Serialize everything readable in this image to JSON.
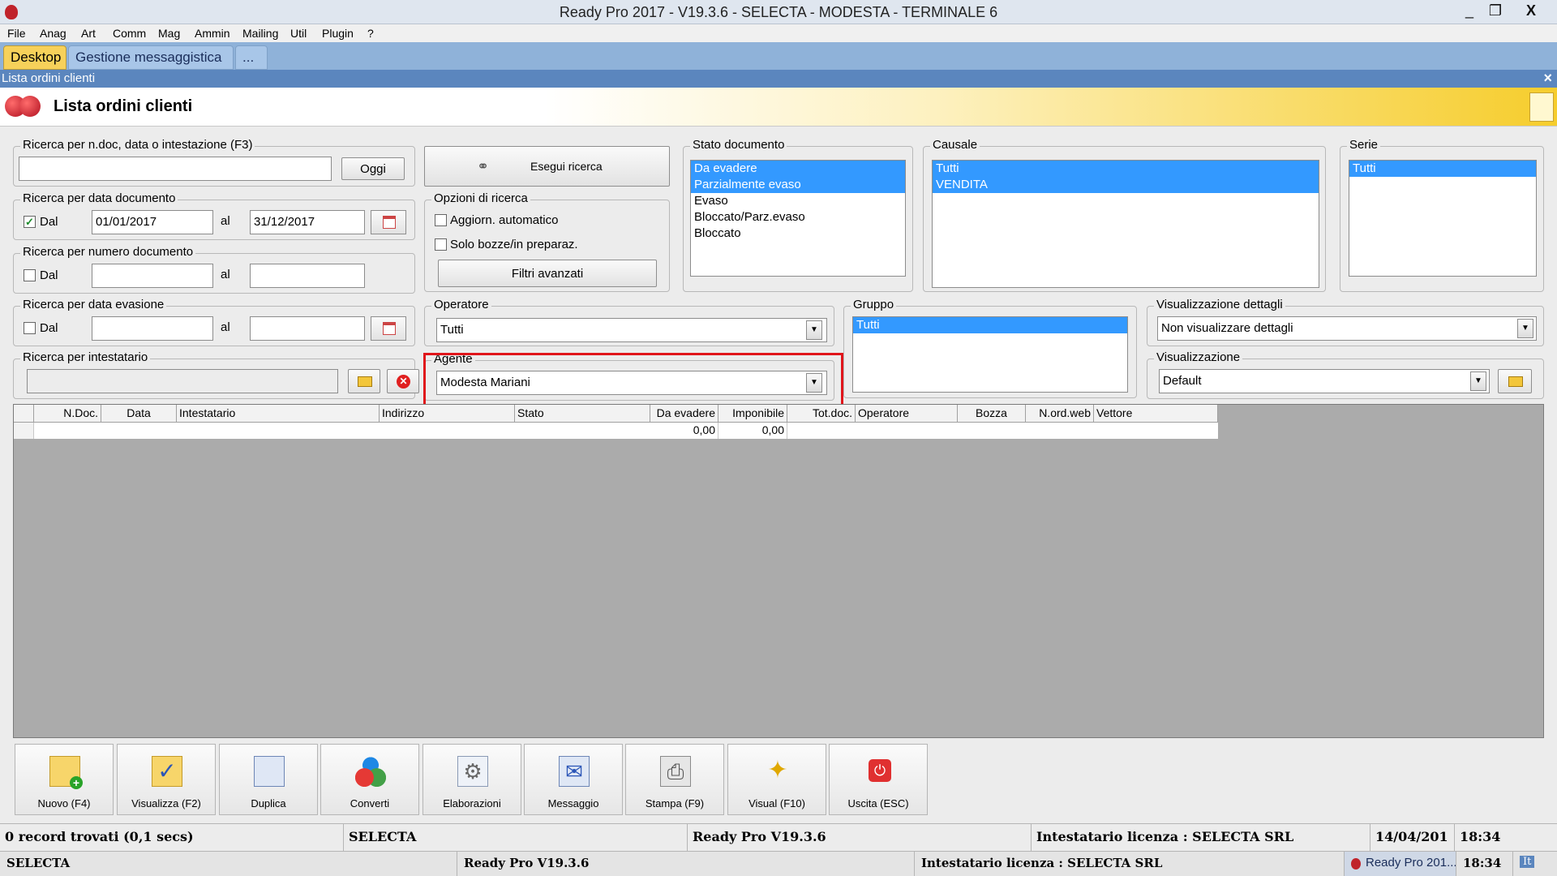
{
  "window": {
    "title": "Ready Pro 2017 - V19.3.6 - SELECTA - MODESTA - TERMINALE 6",
    "min": "_",
    "restore": "❐",
    "close": "X"
  },
  "menu": [
    "File",
    "Anag",
    "Art",
    "Comm",
    "Mag",
    "Ammin",
    "Mailing",
    "Util",
    "Plugin",
    "?"
  ],
  "tabs": {
    "desktop": "Desktop",
    "gestione": "Gestione messaggistica",
    "more": "..."
  },
  "subwindow": {
    "caption": "Lista ordini clienti",
    "close": "×"
  },
  "header": {
    "title": "Lista ordini clienti"
  },
  "search_text": {
    "legend": "Ricerca per n.doc, data o intestazione (F3)",
    "value": "",
    "oggi_button": "Oggi"
  },
  "search_date": {
    "legend": "Ricerca per data documento",
    "dal_label": "Dal",
    "dal_checked": true,
    "from": "01/01/2017",
    "al_label": "al",
    "to": "31/12/2017"
  },
  "search_number": {
    "legend": "Ricerca per numero documento",
    "dal_label": "Dal",
    "from": "",
    "al_label": "al",
    "to": ""
  },
  "search_evasion": {
    "legend": "Ricerca per data evasione",
    "dal_label": "Dal",
    "from": "",
    "al_label": "al",
    "to": ""
  },
  "search_holder": {
    "legend": "Ricerca per intestatario",
    "value": ""
  },
  "execute_button": "Esegui ricerca",
  "options": {
    "legend": "Opzioni di ricerca",
    "auto_update": "Aggiorn. automatico",
    "drafts_only": "Solo bozze/in preparaz.",
    "advanced_filters": "Filtri avanzati"
  },
  "stato_documento": {
    "legend": "Stato documento",
    "items": [
      "Da evadere",
      "Parzialmente evaso",
      "Evaso",
      "Bloccato/Parz.evaso",
      "Bloccato"
    ],
    "selected": [
      "Da evadere",
      "Parzialmente evaso"
    ]
  },
  "causale": {
    "legend": "Causale",
    "items": [
      "Tutti",
      "VENDITA"
    ]
  },
  "serie": {
    "legend": "Serie",
    "items": [
      "Tutti"
    ]
  },
  "operatore": {
    "legend": "Operatore",
    "value": "Tutti"
  },
  "agente": {
    "legend": "Agente",
    "value": "Modesta Mariani"
  },
  "gruppo": {
    "legend": "Gruppo",
    "items": [
      "Tutti"
    ]
  },
  "vis_dettagli": {
    "legend": "Visualizzazione dettagli",
    "value": "Non visualizzare dettagli"
  },
  "visualizzazione": {
    "legend": "Visualizzazione",
    "value": "Default"
  },
  "grid": {
    "columns": [
      "N.Doc.",
      "Data",
      "Intestatario",
      "Indirizzo",
      "Stato",
      "Da evadere",
      "Imponibile",
      "Tot.doc.",
      "Operatore",
      "Bozza",
      "N.ord.web",
      "Vettore"
    ],
    "totals": {
      "da_evadere": "0,00",
      "imponibile": "0,00"
    }
  },
  "toolbar": [
    "Nuovo (F4)",
    "Visualizza (F2)",
    "Duplica",
    "Converti",
    "Elaborazioni",
    "Messaggio",
    "Stampa (F9)",
    "Visual (F10)",
    "Uscita (ESC)"
  ],
  "status1": {
    "records": "0 record trovati (0,1 secs)",
    "company": "SELECTA",
    "version": "Ready Pro V19.3.6",
    "license": "Intestatario licenza : SELECTA SRL",
    "date": "14/04/201",
    "time": "18:34"
  },
  "status2": {
    "company": "SELECTA",
    "version": "Ready Pro V19.3.6",
    "license": "Intestatario licenza : SELECTA SRL",
    "task": "Ready Pro 201...",
    "time": "18:34",
    "lang": "It"
  },
  "colors": {
    "accent": "#3399ff",
    "tab_active": "#f7d15a",
    "highlight": "#e0151b",
    "caption": "#5b86be"
  },
  "icons": [
    "search-binoculars-icon",
    "folder-icon",
    "clear-icon",
    "calendar-icon",
    "new-document-icon",
    "view-icon",
    "duplicate-icon",
    "convert-icon",
    "processing-icon",
    "message-icon",
    "print-icon",
    "visual-icon",
    "exit-icon"
  ]
}
